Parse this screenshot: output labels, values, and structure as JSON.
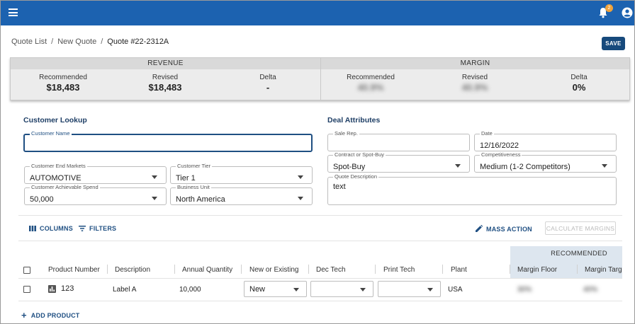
{
  "header": {
    "notification_count": "2",
    "colors": {
      "appbar": "#1c62b0",
      "badge": "#f0a23a",
      "primary": "#174a7c"
    }
  },
  "breadcrumb": {
    "items": [
      "Quote List",
      "New Quote",
      "Quote #22-2312A"
    ]
  },
  "actions": {
    "save_label": "SAVE"
  },
  "summary": {
    "revenue": {
      "title": "REVENUE",
      "recommended_label": "Recommended",
      "recommended_value": "$18,483",
      "revised_label": "Revised",
      "revised_value": "$18,483",
      "delta_label": "Delta",
      "delta_value": "-"
    },
    "margin": {
      "title": "MARGIN",
      "recommended_label": "Recommended",
      "recommended_value": "40.9%",
      "revised_label": "Revised",
      "revised_value": "40.9%",
      "delta_label": "Delta",
      "delta_value": "0%"
    }
  },
  "customer_lookup": {
    "title": "Customer Lookup",
    "customer_name": {
      "label": "Customer Name",
      "value": ""
    },
    "end_markets": {
      "label": "Customer End Markets",
      "value": "AUTOMOTIVE"
    },
    "tier": {
      "label": "Customer Tier",
      "value": "Tier 1"
    },
    "spend": {
      "label": "Customer Achievable Spend",
      "value": "50,000"
    },
    "business_unit": {
      "label": "Business Unit",
      "value": "North America"
    }
  },
  "deal_attributes": {
    "title": "Deal Attributes",
    "sale_rep": {
      "label": "Sale Rep.",
      "value": ""
    },
    "date": {
      "label": "Date",
      "value": "12/16/2022"
    },
    "contract": {
      "label": "Contract or Spot-Buy",
      "value": "Spot-Buy"
    },
    "competitiveness": {
      "label": "Competitiveness",
      "value": "Medium (1-2 Competitors)"
    },
    "quote_description": {
      "label": "Quote Description",
      "value": "text"
    }
  },
  "toolbar": {
    "columns": "COLUMNS",
    "filters": "FILTERS",
    "mass_action": "MASS ACTION",
    "calculate_margins": "CALCULATE MARGINS"
  },
  "table": {
    "group_header": "RECOMMENDED",
    "columns": [
      "Product Number",
      "Description",
      "Annual Quantity",
      "New or Existing",
      "Dec Tech",
      "Print Tech",
      "Plant",
      "Margin Floor",
      "Margin Target"
    ],
    "rows": [
      {
        "product_number": "123",
        "description": "Label A",
        "annual_quantity": "10,000",
        "new_or_existing": "New",
        "dec_tech": "",
        "print_tech": "",
        "plant": "USA",
        "margin_floor": "30%",
        "margin_target": "40%"
      }
    ]
  },
  "add_product": "ADD PRODUCT"
}
